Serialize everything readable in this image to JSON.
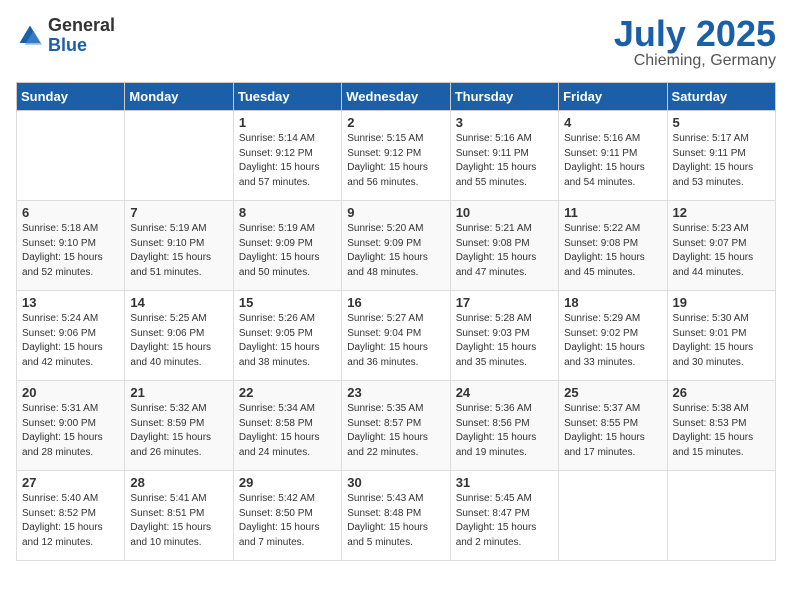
{
  "logo": {
    "general": "General",
    "blue": "Blue"
  },
  "title": "July 2025",
  "location": "Chieming, Germany",
  "days_of_week": [
    "Sunday",
    "Monday",
    "Tuesday",
    "Wednesday",
    "Thursday",
    "Friday",
    "Saturday"
  ],
  "weeks": [
    [
      {
        "day": "",
        "info": ""
      },
      {
        "day": "",
        "info": ""
      },
      {
        "day": "1",
        "info": "Sunrise: 5:14 AM\nSunset: 9:12 PM\nDaylight: 15 hours\nand 57 minutes."
      },
      {
        "day": "2",
        "info": "Sunrise: 5:15 AM\nSunset: 9:12 PM\nDaylight: 15 hours\nand 56 minutes."
      },
      {
        "day": "3",
        "info": "Sunrise: 5:16 AM\nSunset: 9:11 PM\nDaylight: 15 hours\nand 55 minutes."
      },
      {
        "day": "4",
        "info": "Sunrise: 5:16 AM\nSunset: 9:11 PM\nDaylight: 15 hours\nand 54 minutes."
      },
      {
        "day": "5",
        "info": "Sunrise: 5:17 AM\nSunset: 9:11 PM\nDaylight: 15 hours\nand 53 minutes."
      }
    ],
    [
      {
        "day": "6",
        "info": "Sunrise: 5:18 AM\nSunset: 9:10 PM\nDaylight: 15 hours\nand 52 minutes."
      },
      {
        "day": "7",
        "info": "Sunrise: 5:19 AM\nSunset: 9:10 PM\nDaylight: 15 hours\nand 51 minutes."
      },
      {
        "day": "8",
        "info": "Sunrise: 5:19 AM\nSunset: 9:09 PM\nDaylight: 15 hours\nand 50 minutes."
      },
      {
        "day": "9",
        "info": "Sunrise: 5:20 AM\nSunset: 9:09 PM\nDaylight: 15 hours\nand 48 minutes."
      },
      {
        "day": "10",
        "info": "Sunrise: 5:21 AM\nSunset: 9:08 PM\nDaylight: 15 hours\nand 47 minutes."
      },
      {
        "day": "11",
        "info": "Sunrise: 5:22 AM\nSunset: 9:08 PM\nDaylight: 15 hours\nand 45 minutes."
      },
      {
        "day": "12",
        "info": "Sunrise: 5:23 AM\nSunset: 9:07 PM\nDaylight: 15 hours\nand 44 minutes."
      }
    ],
    [
      {
        "day": "13",
        "info": "Sunrise: 5:24 AM\nSunset: 9:06 PM\nDaylight: 15 hours\nand 42 minutes."
      },
      {
        "day": "14",
        "info": "Sunrise: 5:25 AM\nSunset: 9:06 PM\nDaylight: 15 hours\nand 40 minutes."
      },
      {
        "day": "15",
        "info": "Sunrise: 5:26 AM\nSunset: 9:05 PM\nDaylight: 15 hours\nand 38 minutes."
      },
      {
        "day": "16",
        "info": "Sunrise: 5:27 AM\nSunset: 9:04 PM\nDaylight: 15 hours\nand 36 minutes."
      },
      {
        "day": "17",
        "info": "Sunrise: 5:28 AM\nSunset: 9:03 PM\nDaylight: 15 hours\nand 35 minutes."
      },
      {
        "day": "18",
        "info": "Sunrise: 5:29 AM\nSunset: 9:02 PM\nDaylight: 15 hours\nand 33 minutes."
      },
      {
        "day": "19",
        "info": "Sunrise: 5:30 AM\nSunset: 9:01 PM\nDaylight: 15 hours\nand 30 minutes."
      }
    ],
    [
      {
        "day": "20",
        "info": "Sunrise: 5:31 AM\nSunset: 9:00 PM\nDaylight: 15 hours\nand 28 minutes."
      },
      {
        "day": "21",
        "info": "Sunrise: 5:32 AM\nSunset: 8:59 PM\nDaylight: 15 hours\nand 26 minutes."
      },
      {
        "day": "22",
        "info": "Sunrise: 5:34 AM\nSunset: 8:58 PM\nDaylight: 15 hours\nand 24 minutes."
      },
      {
        "day": "23",
        "info": "Sunrise: 5:35 AM\nSunset: 8:57 PM\nDaylight: 15 hours\nand 22 minutes."
      },
      {
        "day": "24",
        "info": "Sunrise: 5:36 AM\nSunset: 8:56 PM\nDaylight: 15 hours\nand 19 minutes."
      },
      {
        "day": "25",
        "info": "Sunrise: 5:37 AM\nSunset: 8:55 PM\nDaylight: 15 hours\nand 17 minutes."
      },
      {
        "day": "26",
        "info": "Sunrise: 5:38 AM\nSunset: 8:53 PM\nDaylight: 15 hours\nand 15 minutes."
      }
    ],
    [
      {
        "day": "27",
        "info": "Sunrise: 5:40 AM\nSunset: 8:52 PM\nDaylight: 15 hours\nand 12 minutes."
      },
      {
        "day": "28",
        "info": "Sunrise: 5:41 AM\nSunset: 8:51 PM\nDaylight: 15 hours\nand 10 minutes."
      },
      {
        "day": "29",
        "info": "Sunrise: 5:42 AM\nSunset: 8:50 PM\nDaylight: 15 hours\nand 7 minutes."
      },
      {
        "day": "30",
        "info": "Sunrise: 5:43 AM\nSunset: 8:48 PM\nDaylight: 15 hours\nand 5 minutes."
      },
      {
        "day": "31",
        "info": "Sunrise: 5:45 AM\nSunset: 8:47 PM\nDaylight: 15 hours\nand 2 minutes."
      },
      {
        "day": "",
        "info": ""
      },
      {
        "day": "",
        "info": ""
      }
    ]
  ]
}
